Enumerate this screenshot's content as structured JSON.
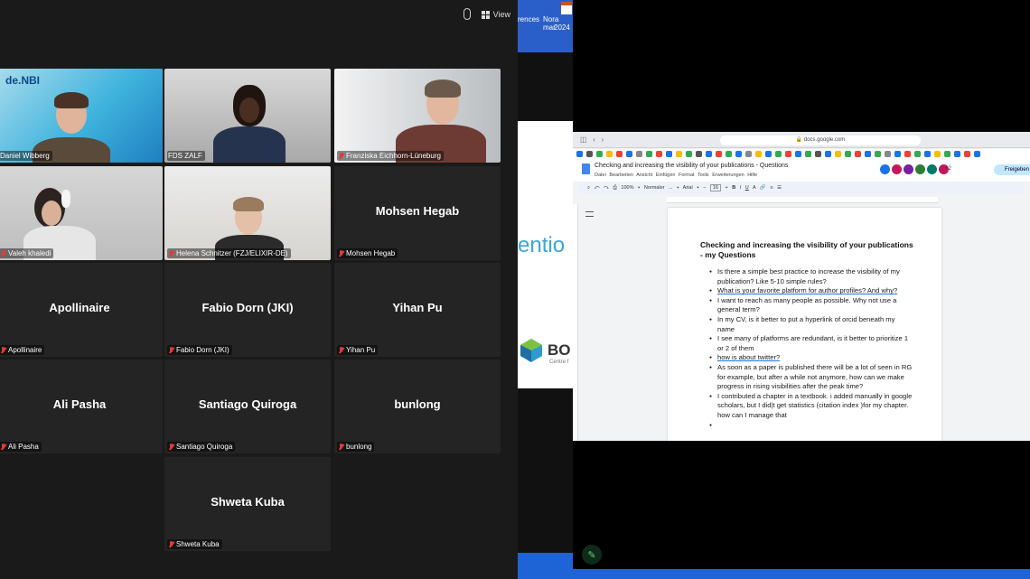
{
  "meeting": {
    "view_label": "View",
    "tiles": [
      {
        "name": "Daniel Wibberg",
        "type": "video",
        "active": true,
        "logo_text": "de.NBI"
      },
      {
        "name": "FDS ZALF",
        "type": "video"
      },
      {
        "name": "Franziska Eichhorn-Lüneburg",
        "type": "video"
      },
      {
        "name": "Valeh khaledi",
        "type": "video"
      },
      {
        "name": "Helena Schnitzer (FZJ/ELIXIR-DE)",
        "type": "video"
      },
      {
        "name": "Mohsen Hegab",
        "type": "name"
      },
      {
        "name": "Apollinaire",
        "type": "name"
      },
      {
        "name": "Fabio Dorn (JKI)",
        "type": "name"
      },
      {
        "name": "Yihan Pu",
        "type": "name"
      },
      {
        "name": "Ali Pasha",
        "type": "name"
      },
      {
        "name": "Santiago Quiroga",
        "type": "name"
      },
      {
        "name": "bunlong",
        "type": "name"
      },
      {
        "name": "Shweta Kuba",
        "type": "name"
      }
    ]
  },
  "shared_screen": {
    "desktop_items": [
      "rences",
      "Nora mar",
      "2024"
    ],
    "slide_word": "entio",
    "logo_text": "BO",
    "logo_sub": "Centre f"
  },
  "browser": {
    "address": "docs.google.com",
    "doc_title": "Checking and increasing the visibility of your publications - Questions",
    "menu": [
      "Datei",
      "Bearbeiten",
      "Ansicht",
      "Einfügen",
      "Format",
      "Tools",
      "Erweiterungen",
      "Hilfe"
    ],
    "menu_text": "Datei Bearbeiten Ansicht Einfügen Format Tools Erweiterungen Hilfe",
    "share_label": "Freigeben",
    "collaborator_count": "+2",
    "toolbar": {
      "zoom": "100%",
      "style": "Normaler ...",
      "font": "Arial",
      "size": "16"
    },
    "heading": "Checking and increasing the visibility of your publications - my Questions",
    "bullets": [
      "Is there a simple best practice to increase the visibility of my publication? Like 5-10 simple rules?",
      "What is your favorite platform for author profiles? And why?",
      "I want to reach as many people as possible. Why not use a general term?",
      "In my CV, is it better to put a hyperlink of orcid beneath my name",
      "I see many of platforms are redundant, is it better to prioritize 1 or 2 of them",
      "how is about twitter?",
      "As soon as a paper is published there will be a lot of seen in RG for example, but after a while not anymore, how can we make progress in rising visibilities after the peak time?",
      "I contributed a chapter in a textbook. i added manually in google scholars, but I did|t get statistics (citation index )for my chapter. how can I manage that"
    ]
  },
  "colors": {
    "active_border": "#b6e26a",
    "tile_bg": "#242424",
    "mic_off": "#e03b3b",
    "share_btn": "#c2e7ff",
    "taskbar_blue": "#1f64d6"
  }
}
